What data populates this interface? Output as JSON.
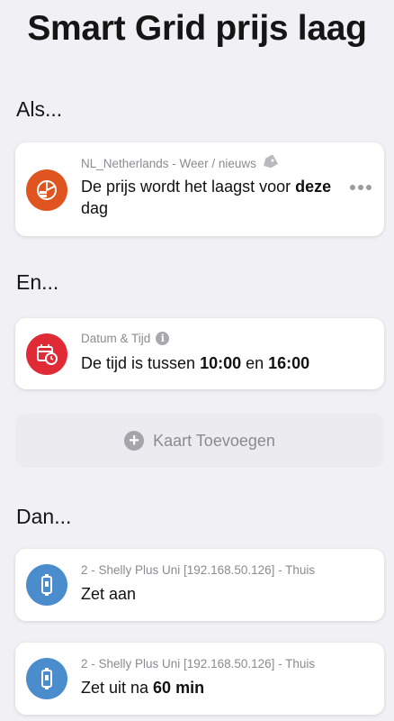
{
  "page": {
    "title": "Smart Grid prijs laag"
  },
  "sections": {
    "if": "Als...",
    "and": "En...",
    "then": "Dan..."
  },
  "when_card": {
    "source": "NL_Netherlands - Weer / nieuws",
    "text_pre": "De prijs wordt het laagst voor ",
    "text_bold1": "deze",
    "text_bold2": "dag",
    "icon": "price-chart-icon",
    "icon_color": "#e0551f"
  },
  "and_card": {
    "source": "Datum & Tijd",
    "text_pre": "De tijd is tussen ",
    "start": "10:00",
    "mid": " en ",
    "end": "16:00",
    "icon": "calendar-clock-icon",
    "icon_color": "#e02a35"
  },
  "add_card": {
    "label": "Kaart Toevoegen"
  },
  "then_cards": [
    {
      "source": "2 - Shelly Plus Uni [192.168.50.126] - Thuis",
      "text": "Zet aan",
      "icon": "shelly-device-icon",
      "icon_color": "#4a8ccc"
    },
    {
      "source": "2 - Shelly Plus Uni [192.168.50.126] - Thuis",
      "text_pre": "Zet uit na ",
      "text_bold": "60 min",
      "icon": "shelly-device-icon",
      "icon_color": "#4a8ccc"
    }
  ]
}
